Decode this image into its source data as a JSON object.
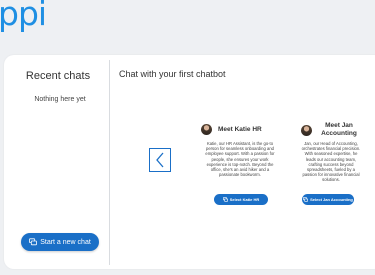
{
  "app": {
    "logo_text": "ppi"
  },
  "sidebar": {
    "title": "Recent chats",
    "empty_message": "Nothing here yet",
    "new_chat_label": "Start a new chat"
  },
  "main": {
    "title": "Chat with your first chatbot",
    "bots": [
      {
        "name": "Meet Katie HR",
        "bio": "Katie, our HR Assistant, is the go-to person for seamless onboarding and employee support. With a passion for people, she ensures your work experience is top-notch. Beyond the office, she's an avid hiker and a passionate bookworm.",
        "select_label": "Select Katie HR"
      },
      {
        "name": "Meet Jan Accounting",
        "bio": "Jan, our Head of Accounting, orchestrates financial precision. With seasoned expertise, he leads our accounting team, crafting success beyond spreadsheets, fueled by a passion for innovative financial solutions.",
        "select_label": "Select Jan Accounting"
      }
    ]
  },
  "colors": {
    "brand": "#1f8fe3",
    "accent": "#1a6fc7",
    "background": "#eef0f3"
  },
  "icons": {
    "prev": "chevron-left-icon",
    "chat": "chat-bubble-icon"
  }
}
